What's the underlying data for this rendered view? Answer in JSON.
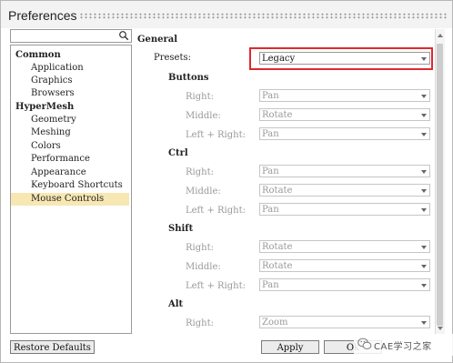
{
  "window": {
    "title": "Preferences"
  },
  "search": {
    "placeholder": ""
  },
  "tree": [
    {
      "label": "Common",
      "type": "group"
    },
    {
      "label": "Application",
      "type": "leaf"
    },
    {
      "label": "Graphics",
      "type": "leaf"
    },
    {
      "label": "Browsers",
      "type": "leaf"
    },
    {
      "label": "HyperMesh",
      "type": "group"
    },
    {
      "label": "Geometry",
      "type": "leaf"
    },
    {
      "label": "Meshing",
      "type": "leaf"
    },
    {
      "label": "Colors",
      "type": "leaf"
    },
    {
      "label": "Performance",
      "type": "leaf"
    },
    {
      "label": "Appearance",
      "type": "leaf"
    },
    {
      "label": "Keyboard Shortcuts",
      "type": "leaf"
    },
    {
      "label": "Mouse Controls",
      "type": "leaf",
      "selected": true
    }
  ],
  "panel": {
    "section": "General",
    "presets_label": "Presets:",
    "presets_value": "Legacy",
    "buttons": {
      "title": "Buttons",
      "right_label": "Right:",
      "right_value": "Pan",
      "middle_label": "Middle:",
      "middle_value": "Rotate",
      "leftright_label": "Left + Right:",
      "leftright_value": "Pan"
    },
    "ctrl": {
      "title": "Ctrl",
      "right_label": "Right:",
      "right_value": "Pan",
      "middle_label": "Middle:",
      "middle_value": "Rotate",
      "leftright_label": "Left + Right:",
      "leftright_value": "Pan"
    },
    "shift": {
      "title": "Shift",
      "right_label": "Right:",
      "right_value": "Rotate",
      "middle_label": "Middle:",
      "middle_value": "Rotate",
      "leftright_label": "Left + Right:",
      "leftright_value": "Pan"
    },
    "alt": {
      "title": "Alt",
      "right_label": "Right:",
      "right_value": "Zoom"
    }
  },
  "footer": {
    "restore_defaults": "Restore Defaults",
    "apply": "Apply",
    "ok": "Ok"
  },
  "watermark": {
    "text": "CAE学习之家",
    "icon": "wechat-icon"
  },
  "colors": {
    "highlight_box": "#e0282e",
    "selection": "#f7e7b3"
  }
}
